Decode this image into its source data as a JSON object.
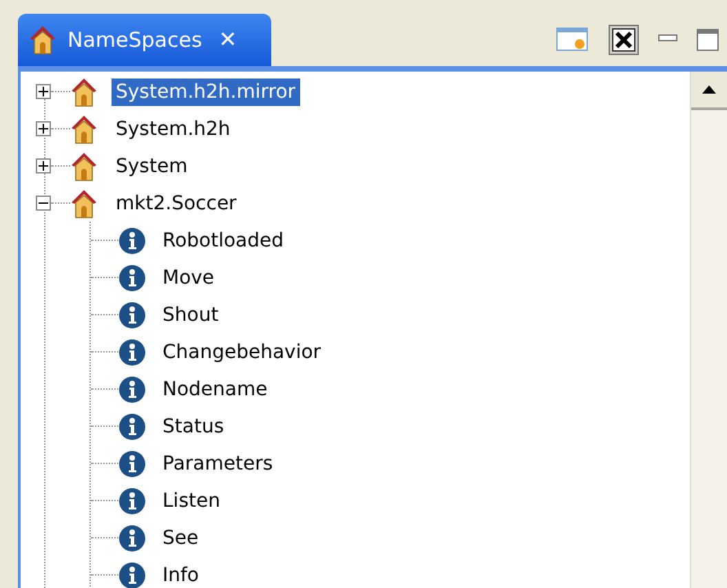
{
  "tab": {
    "title": "NameSpaces",
    "close": "✕"
  },
  "tree": [
    {
      "label": "System.h2h.mirror",
      "expanded": false,
      "selected": true
    },
    {
      "label": "System.h2h",
      "expanded": false,
      "selected": false
    },
    {
      "label": "System",
      "expanded": false,
      "selected": false
    },
    {
      "label": "mkt2.Soccer",
      "expanded": true,
      "selected": false,
      "children": [
        {
          "label": "Robotloaded",
          "selected": false
        },
        {
          "label": "Move",
          "selected": false
        },
        {
          "label": "Shout",
          "selected": false
        },
        {
          "label": "Changebehavior",
          "selected": false
        },
        {
          "label": "Nodename",
          "selected": false
        },
        {
          "label": "Status",
          "selected": false
        },
        {
          "label": "Parameters",
          "selected": false
        },
        {
          "label": "Listen",
          "selected": false
        },
        {
          "label": "See",
          "selected": false
        },
        {
          "label": "Info",
          "selected": false
        }
      ]
    }
  ]
}
